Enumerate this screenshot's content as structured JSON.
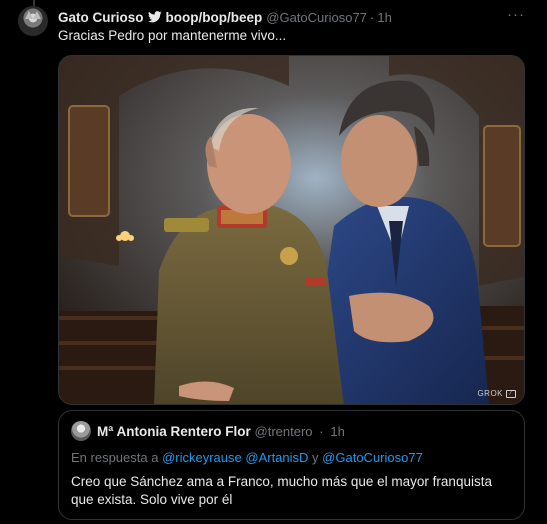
{
  "tweet": {
    "author_name": "Gato Curioso",
    "bird_icon": "twitter-bird-icon",
    "author_suffix": "boop/bop/beep",
    "handle": "@GatoCurioso77",
    "separator": "·",
    "time": "1h",
    "more_label": "···",
    "text": "Gracias Pedro por mantenerme vivo...",
    "media_watermark": "GROK"
  },
  "quote": {
    "author_name": "Mª Antonia Rentero Flor",
    "handle": "@trentero",
    "separator": "·",
    "time": "1h",
    "reply_prefix": "En respuesta a",
    "mention_1": "@rickeyrause",
    "mention_2": "@ArtanisD",
    "reply_and": "y",
    "mention_3": "@GatoCurioso77",
    "text": "Creo que Sánchez ama a Franco, mucho más que el mayor franquista que exista. Solo vive por él"
  },
  "colors": {
    "background": "#000000",
    "text": "#e7e9ea",
    "secondary": "#71767b",
    "link": "#1d9bf0",
    "border": "#2f3336"
  }
}
